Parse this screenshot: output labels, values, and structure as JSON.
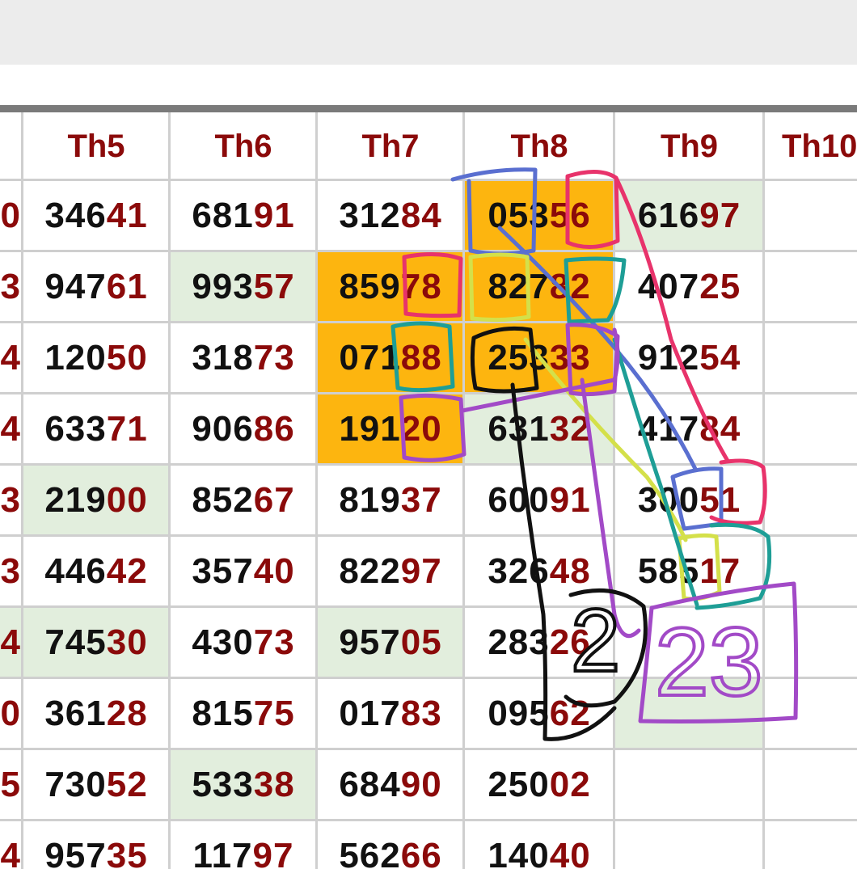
{
  "table": {
    "headers": [
      "",
      "Th5",
      "Th6",
      "Th7",
      "Th8",
      "Th9",
      "Th10"
    ],
    "stub": [
      "0",
      "3",
      "4",
      "4",
      "3",
      "3",
      "4",
      "0",
      "5",
      "4"
    ],
    "rows": [
      [
        {
          "head": "346",
          "tail": "41"
        },
        {
          "head": "681",
          "tail": "91"
        },
        {
          "head": "312",
          "tail": "84"
        },
        {
          "head": "053",
          "tail": "56"
        },
        {
          "head": "616",
          "tail": "97"
        },
        {
          "head": "",
          "tail": ""
        }
      ],
      [
        {
          "head": "947",
          "tail": "61"
        },
        {
          "head": "993",
          "tail": "57"
        },
        {
          "head": "859",
          "tail": "78"
        },
        {
          "head": "827",
          "tail": "82"
        },
        {
          "head": "407",
          "tail": "25"
        },
        {
          "head": "",
          "tail": ""
        }
      ],
      [
        {
          "head": "120",
          "tail": "50"
        },
        {
          "head": "318",
          "tail": "73"
        },
        {
          "head": "071",
          "tail": "88"
        },
        {
          "head": "253",
          "tail": "33"
        },
        {
          "head": "912",
          "tail": "54"
        },
        {
          "head": "",
          "tail": ""
        }
      ],
      [
        {
          "head": "633",
          "tail": "71"
        },
        {
          "head": "906",
          "tail": "86"
        },
        {
          "head": "191",
          "tail": "20"
        },
        {
          "head": "631",
          "tail": "32"
        },
        {
          "head": "417",
          "tail": "84"
        },
        {
          "head": "",
          "tail": ""
        }
      ],
      [
        {
          "head": "219",
          "tail": "00"
        },
        {
          "head": "852",
          "tail": "67"
        },
        {
          "head": "819",
          "tail": "37"
        },
        {
          "head": "600",
          "tail": "91"
        },
        {
          "head": "300",
          "tail": "51"
        },
        {
          "head": "",
          "tail": ""
        }
      ],
      [
        {
          "head": "446",
          "tail": "42"
        },
        {
          "head": "357",
          "tail": "40"
        },
        {
          "head": "822",
          "tail": "97"
        },
        {
          "head": "326",
          "tail": "48"
        },
        {
          "head": "585",
          "tail": "17"
        },
        {
          "head": "",
          "tail": ""
        }
      ],
      [
        {
          "head": "745",
          "tail": "30"
        },
        {
          "head": "430",
          "tail": "73"
        },
        {
          "head": "957",
          "tail": "05"
        },
        {
          "head": "283",
          "tail": "26"
        },
        {
          "head": "",
          "tail": ""
        },
        {
          "head": "",
          "tail": ""
        }
      ],
      [
        {
          "head": "361",
          "tail": "28"
        },
        {
          "head": "815",
          "tail": "75"
        },
        {
          "head": "017",
          "tail": "83"
        },
        {
          "head": "095",
          "tail": "62"
        },
        {
          "head": "",
          "tail": ""
        },
        {
          "head": "",
          "tail": ""
        }
      ],
      [
        {
          "head": "730",
          "tail": "52"
        },
        {
          "head": "533",
          "tail": "38"
        },
        {
          "head": "684",
          "tail": "90"
        },
        {
          "head": "250",
          "tail": "02"
        },
        {
          "head": "",
          "tail": ""
        },
        {
          "head": "",
          "tail": ""
        }
      ],
      [
        {
          "head": "957",
          "tail": "35"
        },
        {
          "head": "117",
          "tail": "97"
        },
        {
          "head": "562",
          "tail": "66"
        },
        {
          "head": "140",
          "tail": "40"
        },
        {
          "head": "",
          "tail": ""
        },
        {
          "head": "",
          "tail": ""
        }
      ]
    ],
    "highlight_green": [
      [
        0,
        4
      ],
      [
        1,
        1
      ],
      [
        3,
        3
      ],
      [
        4,
        0
      ],
      [
        6,
        0
      ],
      [
        6,
        2
      ],
      [
        7,
        4
      ],
      [
        8,
        1
      ],
      [
        5,
        6
      ]
    ],
    "highlight_orange": [
      [
        0,
        3
      ],
      [
        1,
        2
      ],
      [
        1,
        3
      ],
      [
        2,
        2
      ],
      [
        2,
        3
      ],
      [
        3,
        2
      ]
    ]
  },
  "annotations": {
    "note_black": "2",
    "note_purple": "23"
  },
  "colors": {
    "header_text": "#8b0a0a",
    "tail_text": "#8b0a0a",
    "body_text": "#111111",
    "green_fill": "#e2eedd",
    "orange_fill": "#fdb50f",
    "grid_line": "#cfcfcf",
    "rule": "#7a7a7a",
    "top_bar": "#ececec"
  }
}
